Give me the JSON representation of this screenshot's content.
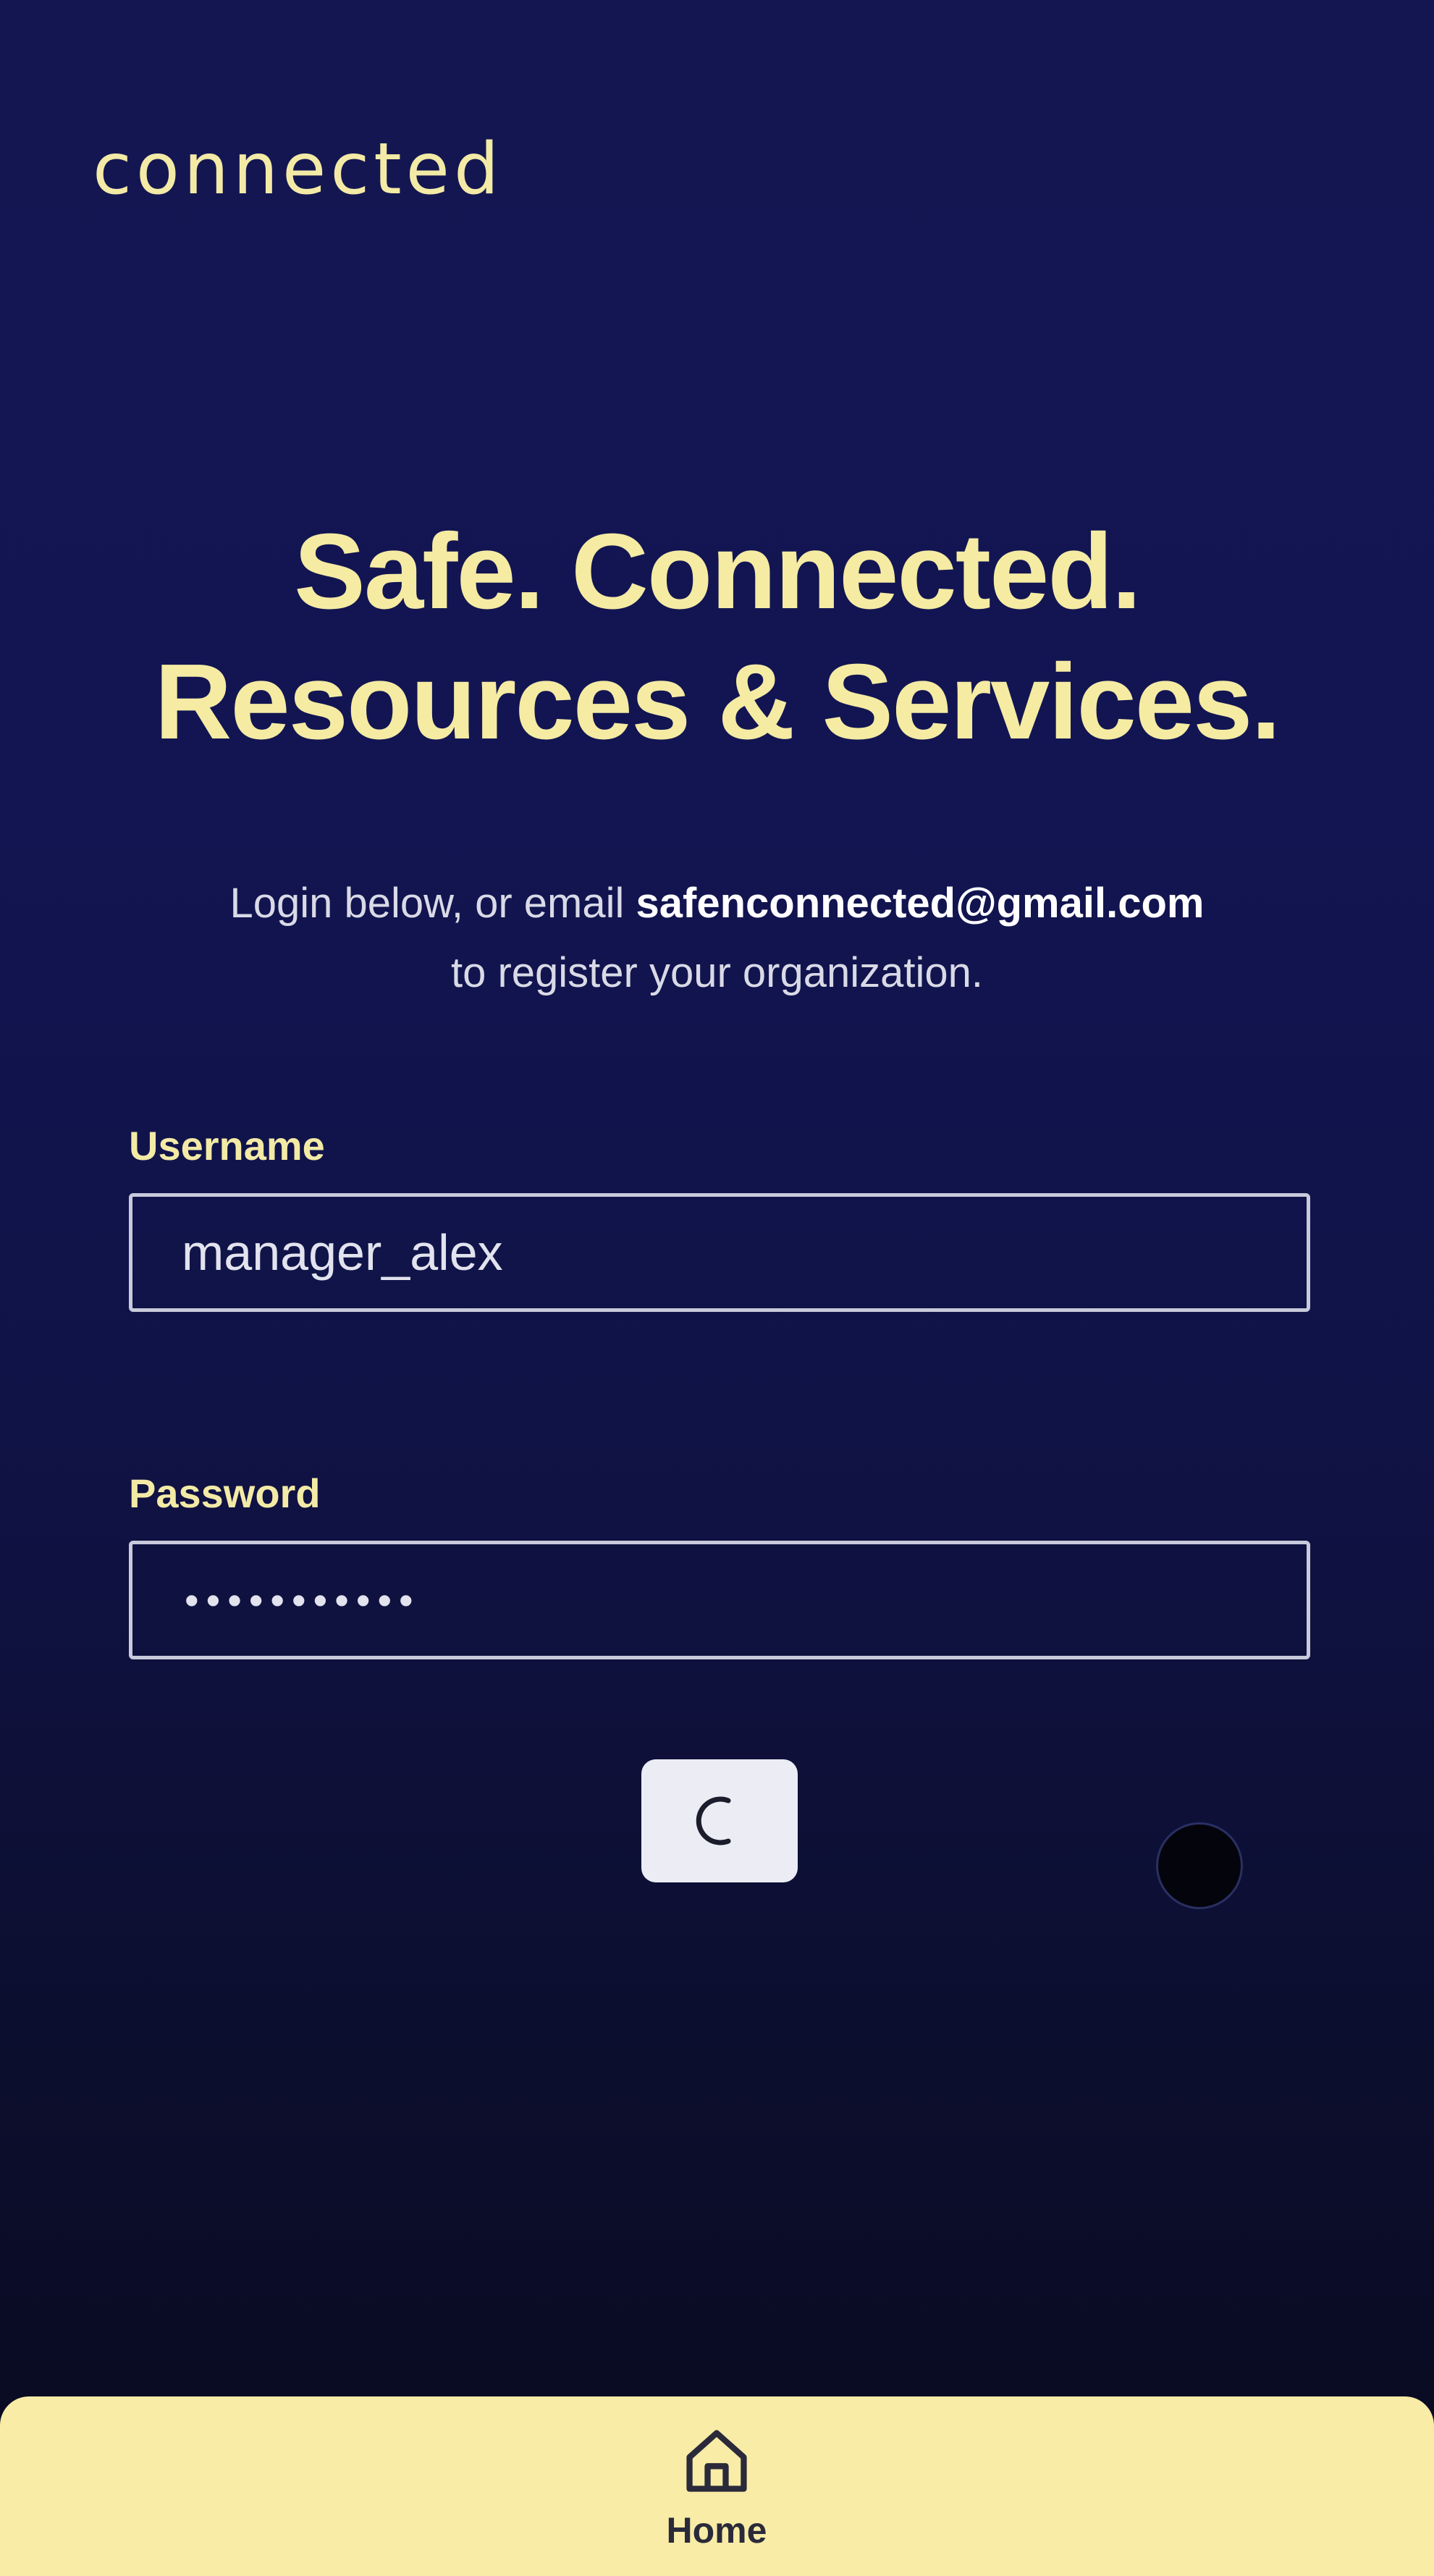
{
  "app": {
    "logo_text": "connected"
  },
  "hero": {
    "headline_line1": "Safe. Connected.",
    "headline_line2": "Resources & Services.",
    "subtext_prefix": "Login below, or email ",
    "contact_email": "safenconnected@gmail.com",
    "subtext_suffix": "to register your organization."
  },
  "form": {
    "username": {
      "label": "Username",
      "value": "manager_alex"
    },
    "password": {
      "label": "Password",
      "masked_value": "•••••••••••"
    },
    "submit": {
      "state": "loading",
      "icon": "spinner-icon"
    }
  },
  "bottom_nav": {
    "items": [
      {
        "label": "Home",
        "icon": "home-icon"
      }
    ]
  },
  "colors": {
    "accent": "#f5eba3",
    "background": "#121552",
    "nav_background": "#f8eca7"
  }
}
